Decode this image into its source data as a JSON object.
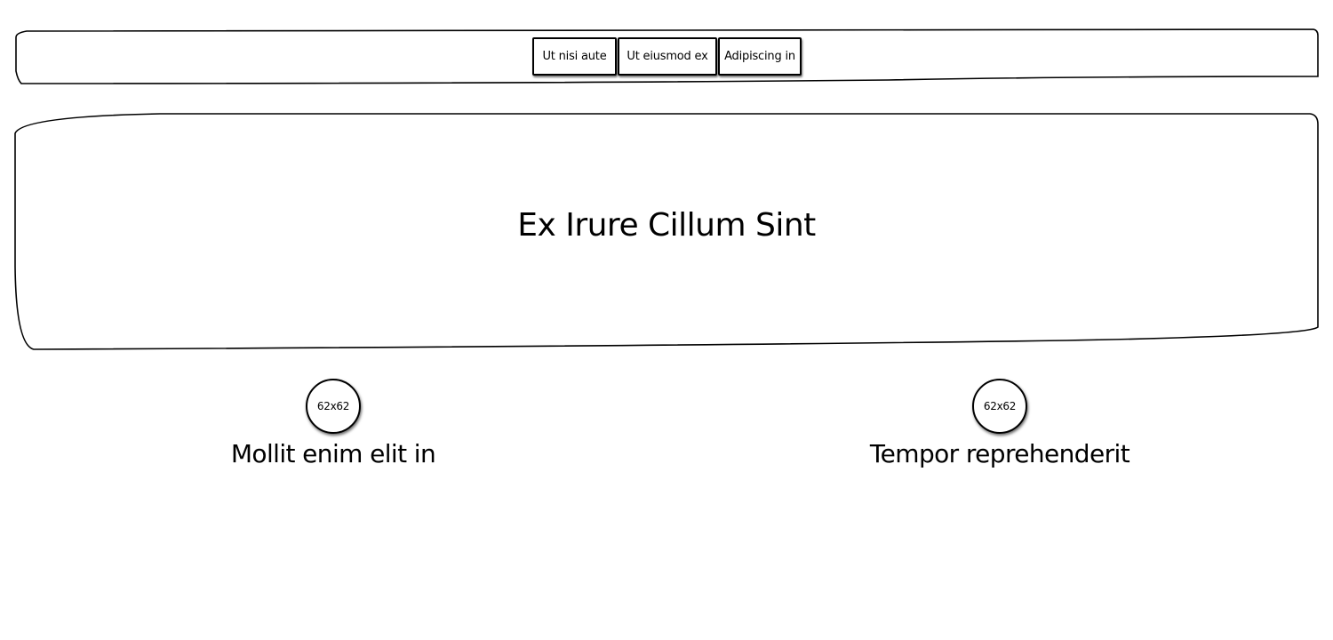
{
  "nav": {
    "buttons": [
      {
        "label": "Ut nisi aute"
      },
      {
        "label": "Ut eiusmod ex"
      },
      {
        "label": "Adipiscing in"
      }
    ]
  },
  "hero": {
    "title": "Ex Irure Cillum Sint"
  },
  "features": [
    {
      "image_label": "62x62",
      "title": "Mollit enim elit in"
    },
    {
      "image_label": "62x62",
      "title": "Tempor reprehenderit"
    }
  ]
}
